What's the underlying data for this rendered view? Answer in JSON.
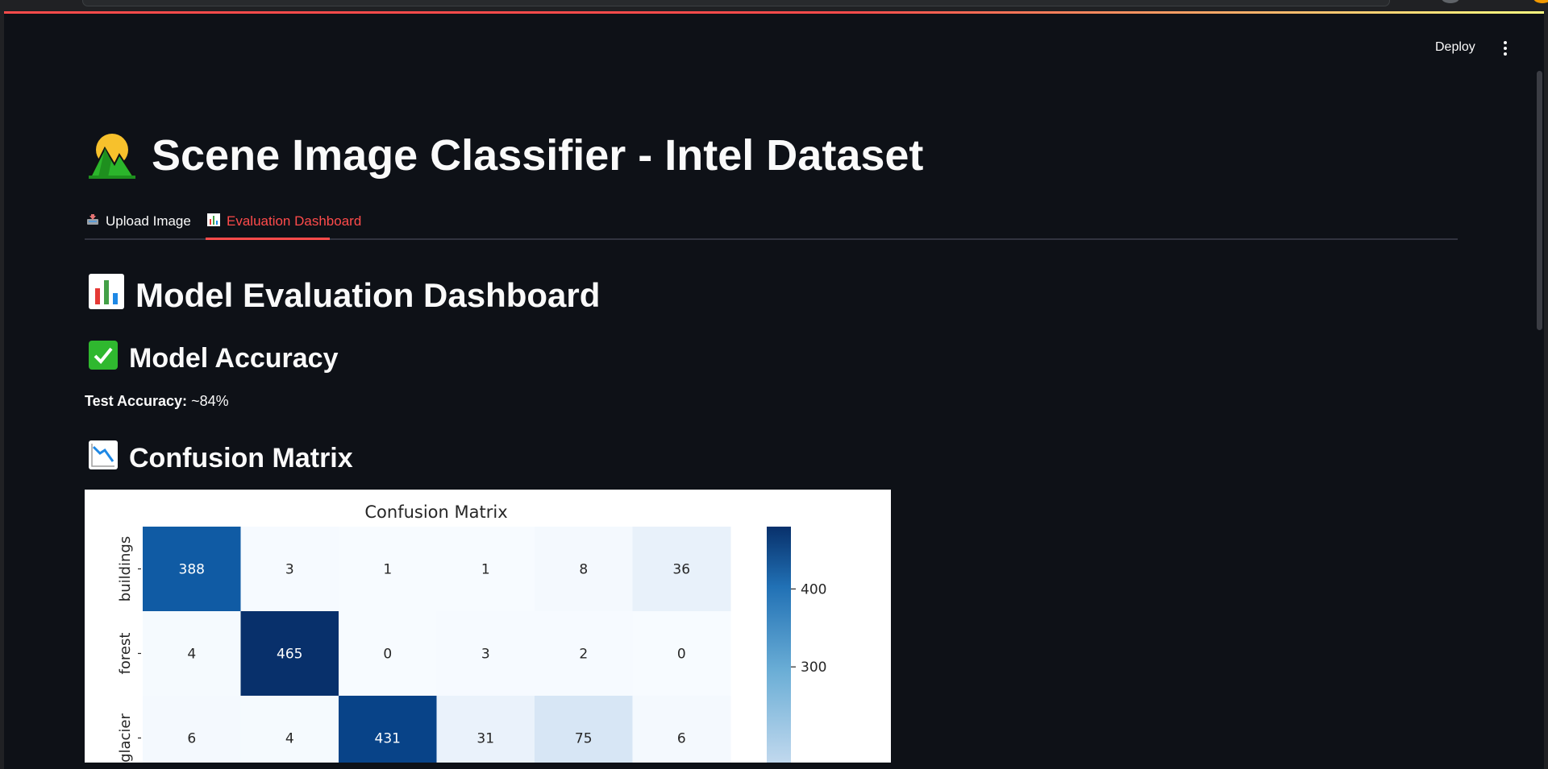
{
  "header": {
    "deploy_label": "Deploy",
    "menu_icon": "kebab-menu-icon"
  },
  "title": {
    "icon": "sunrise-over-mountains-icon",
    "text": "Scene Image Classifier - Intel Dataset"
  },
  "tabs": [
    {
      "label": "Upload Image",
      "icon": "inbox-tray-icon",
      "active": false
    },
    {
      "label": "Evaluation Dashboard",
      "icon": "bar-chart-icon",
      "active": true
    }
  ],
  "dashboard": {
    "heading": "Model Evaluation Dashboard",
    "heading_icon": "bar-chart-icon",
    "accuracy_heading": "Model Accuracy",
    "accuracy_icon": "check-mark-icon",
    "accuracy_label": "Test Accuracy:",
    "accuracy_value": "~84%",
    "cm_heading": "Confusion Matrix",
    "cm_icon": "chart-decreasing-icon"
  },
  "colors": {
    "background": "#0e1117",
    "accent": "#ff4b4b",
    "text": "#fafafa"
  },
  "chart_data": {
    "type": "heatmap",
    "title": "Confusion Matrix",
    "row_labels": [
      "buildings",
      "forest",
      "glacier"
    ],
    "column_labels": [],
    "values": [
      [
        388,
        3,
        1,
        1,
        8,
        36
      ],
      [
        4,
        465,
        0,
        3,
        2,
        0
      ],
      [
        6,
        4,
        431,
        31,
        75,
        6
      ]
    ],
    "colorbar_ticks": [
      300,
      400
    ],
    "colormap": "Blues"
  }
}
